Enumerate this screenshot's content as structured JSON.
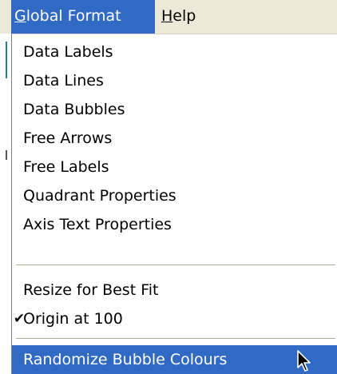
{
  "menubar": {
    "global_format": "Global Format",
    "help": "Help"
  },
  "menu": {
    "items": [
      {
        "label": "Data Labels"
      },
      {
        "label": "Data Lines"
      },
      {
        "label": "Data Bubbles"
      },
      {
        "label": "Free Arrows"
      },
      {
        "label": "Free Labels"
      },
      {
        "label": "Quadrant Properties"
      },
      {
        "label": "Axis Text Properties"
      },
      {
        "label": "Resize for Best Fit"
      },
      {
        "label": "Origin at 100",
        "checked": true
      },
      {
        "label": "Randomize Bubble Colours",
        "highlighted": true
      }
    ],
    "check_glyph": "✔"
  },
  "colors": {
    "highlight": "#316ac5",
    "menubar": "#ece9d8"
  }
}
